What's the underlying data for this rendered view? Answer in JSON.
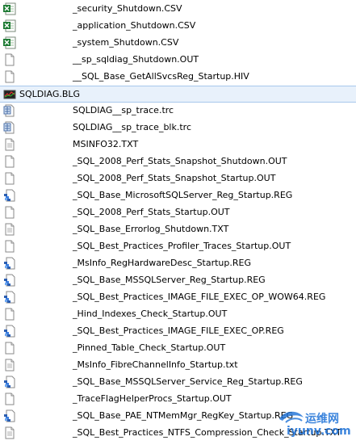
{
  "files": [
    {
      "name": "_security_Shutdown.CSV",
      "icon": "excel-icon"
    },
    {
      "name": "_application_Shutdown.CSV",
      "icon": "excel-icon"
    },
    {
      "name": "_system_Shutdown.CSV",
      "icon": "excel-icon"
    },
    {
      "name": "__sp_sqldiag_Shutdown.OUT",
      "icon": "file-icon"
    },
    {
      "name": "__SQL_Base_GetAllSvcsReg_Startup.HIV",
      "icon": "file-icon"
    },
    {
      "name": "SQLDIAG.BLG",
      "icon": "perfmon-icon",
      "selected": true
    },
    {
      "name": "SQLDIAG__sp_trace.trc",
      "icon": "trace-icon"
    },
    {
      "name": "SQLDIAG__sp_trace_blk.trc",
      "icon": "trace-icon"
    },
    {
      "name": "MSINFO32.TXT",
      "icon": "text-file-icon"
    },
    {
      "name": "_SQL_2008_Perf_Stats_Snapshot_Shutdown.OUT",
      "icon": "file-icon"
    },
    {
      "name": "_SQL_2008_Perf_Stats_Snapshot_Startup.OUT",
      "icon": "file-icon"
    },
    {
      "name": "_SQL_Base_MicrosoftSQLServer_Reg_Startup.REG",
      "icon": "registry-icon"
    },
    {
      "name": "_SQL_2008_Perf_Stats_Startup.OUT",
      "icon": "file-icon"
    },
    {
      "name": "_SQL_Base_Errorlog_Shutdown.TXT",
      "icon": "text-file-icon"
    },
    {
      "name": "_SQL_Best_Practices_Profiler_Traces_Startup.OUT",
      "icon": "file-icon"
    },
    {
      "name": "_MsInfo_RegHardwareDesc_Startup.REG",
      "icon": "registry-icon"
    },
    {
      "name": "_SQL_Base_MSSQLServer_Reg_Startup.REG",
      "icon": "registry-icon"
    },
    {
      "name": "_SQL_Best_Practices_IMAGE_FILE_EXEC_OP_WOW64.REG",
      "icon": "registry-icon"
    },
    {
      "name": "_Hind_Indexes_Check_Startup.OUT",
      "icon": "file-icon"
    },
    {
      "name": "_SQL_Best_Practices_IMAGE_FILE_EXEC_OP.REG",
      "icon": "registry-icon"
    },
    {
      "name": "_Pinned_Table_Check_Startup.OUT",
      "icon": "file-icon"
    },
    {
      "name": "_MsInfo_FibreChannelInfo_Startup.txt",
      "icon": "text-file-icon"
    },
    {
      "name": "_SQL_Base_MSSQLServer_Service_Reg_Startup.REG",
      "icon": "registry-icon"
    },
    {
      "name": "_TraceFlagHelperProcs_Startup.OUT",
      "icon": "file-icon"
    },
    {
      "name": "_SQL_Base_PAE_NTMemMgr_RegKey_Startup.REG",
      "icon": "registry-icon"
    },
    {
      "name": "_SQL_Best_Practices_NTFS_Compression_Check_Startup.TXT",
      "icon": "text-file-icon"
    }
  ],
  "watermark": {
    "line1": "运维网",
    "line2": "iyunv.com",
    "color": "#1a6fd6"
  },
  "colors": {
    "selection_bg": "#e8f1fb",
    "selection_border": "#a8c8ec",
    "excel_green": "#1e7b34",
    "registry_blue": "#2a5db0"
  }
}
